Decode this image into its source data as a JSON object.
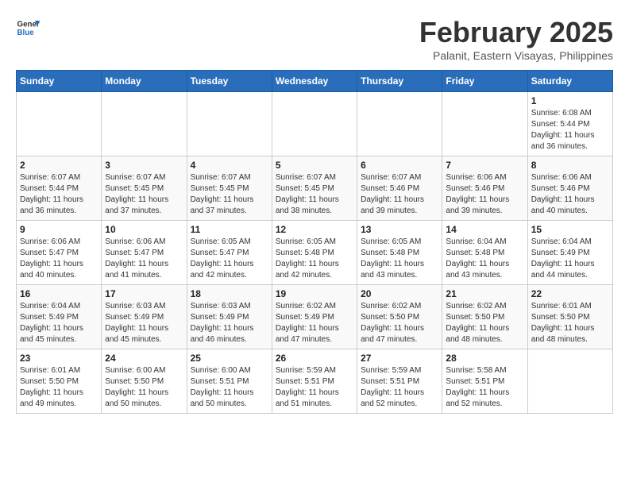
{
  "logo": {
    "text_general": "General",
    "text_blue": "Blue"
  },
  "title": "February 2025",
  "subtitle": "Palanit, Eastern Visayas, Philippines",
  "weekdays": [
    "Sunday",
    "Monday",
    "Tuesday",
    "Wednesday",
    "Thursday",
    "Friday",
    "Saturday"
  ],
  "weeks": [
    [
      {
        "day": "",
        "info": ""
      },
      {
        "day": "",
        "info": ""
      },
      {
        "day": "",
        "info": ""
      },
      {
        "day": "",
        "info": ""
      },
      {
        "day": "",
        "info": ""
      },
      {
        "day": "",
        "info": ""
      },
      {
        "day": "1",
        "info": "Sunrise: 6:08 AM\nSunset: 5:44 PM\nDaylight: 11 hours and 36 minutes."
      }
    ],
    [
      {
        "day": "2",
        "info": "Sunrise: 6:07 AM\nSunset: 5:44 PM\nDaylight: 11 hours and 36 minutes."
      },
      {
        "day": "3",
        "info": "Sunrise: 6:07 AM\nSunset: 5:45 PM\nDaylight: 11 hours and 37 minutes."
      },
      {
        "day": "4",
        "info": "Sunrise: 6:07 AM\nSunset: 5:45 PM\nDaylight: 11 hours and 37 minutes."
      },
      {
        "day": "5",
        "info": "Sunrise: 6:07 AM\nSunset: 5:45 PM\nDaylight: 11 hours and 38 minutes."
      },
      {
        "day": "6",
        "info": "Sunrise: 6:07 AM\nSunset: 5:46 PM\nDaylight: 11 hours and 39 minutes."
      },
      {
        "day": "7",
        "info": "Sunrise: 6:06 AM\nSunset: 5:46 PM\nDaylight: 11 hours and 39 minutes."
      },
      {
        "day": "8",
        "info": "Sunrise: 6:06 AM\nSunset: 5:46 PM\nDaylight: 11 hours and 40 minutes."
      }
    ],
    [
      {
        "day": "9",
        "info": "Sunrise: 6:06 AM\nSunset: 5:47 PM\nDaylight: 11 hours and 40 minutes."
      },
      {
        "day": "10",
        "info": "Sunrise: 6:06 AM\nSunset: 5:47 PM\nDaylight: 11 hours and 41 minutes."
      },
      {
        "day": "11",
        "info": "Sunrise: 6:05 AM\nSunset: 5:47 PM\nDaylight: 11 hours and 42 minutes."
      },
      {
        "day": "12",
        "info": "Sunrise: 6:05 AM\nSunset: 5:48 PM\nDaylight: 11 hours and 42 minutes."
      },
      {
        "day": "13",
        "info": "Sunrise: 6:05 AM\nSunset: 5:48 PM\nDaylight: 11 hours and 43 minutes."
      },
      {
        "day": "14",
        "info": "Sunrise: 6:04 AM\nSunset: 5:48 PM\nDaylight: 11 hours and 43 minutes."
      },
      {
        "day": "15",
        "info": "Sunrise: 6:04 AM\nSunset: 5:49 PM\nDaylight: 11 hours and 44 minutes."
      }
    ],
    [
      {
        "day": "16",
        "info": "Sunrise: 6:04 AM\nSunset: 5:49 PM\nDaylight: 11 hours and 45 minutes."
      },
      {
        "day": "17",
        "info": "Sunrise: 6:03 AM\nSunset: 5:49 PM\nDaylight: 11 hours and 45 minutes."
      },
      {
        "day": "18",
        "info": "Sunrise: 6:03 AM\nSunset: 5:49 PM\nDaylight: 11 hours and 46 minutes."
      },
      {
        "day": "19",
        "info": "Sunrise: 6:02 AM\nSunset: 5:49 PM\nDaylight: 11 hours and 47 minutes."
      },
      {
        "day": "20",
        "info": "Sunrise: 6:02 AM\nSunset: 5:50 PM\nDaylight: 11 hours and 47 minutes."
      },
      {
        "day": "21",
        "info": "Sunrise: 6:02 AM\nSunset: 5:50 PM\nDaylight: 11 hours and 48 minutes."
      },
      {
        "day": "22",
        "info": "Sunrise: 6:01 AM\nSunset: 5:50 PM\nDaylight: 11 hours and 48 minutes."
      }
    ],
    [
      {
        "day": "23",
        "info": "Sunrise: 6:01 AM\nSunset: 5:50 PM\nDaylight: 11 hours and 49 minutes."
      },
      {
        "day": "24",
        "info": "Sunrise: 6:00 AM\nSunset: 5:50 PM\nDaylight: 11 hours and 50 minutes."
      },
      {
        "day": "25",
        "info": "Sunrise: 6:00 AM\nSunset: 5:51 PM\nDaylight: 11 hours and 50 minutes."
      },
      {
        "day": "26",
        "info": "Sunrise: 5:59 AM\nSunset: 5:51 PM\nDaylight: 11 hours and 51 minutes."
      },
      {
        "day": "27",
        "info": "Sunrise: 5:59 AM\nSunset: 5:51 PM\nDaylight: 11 hours and 52 minutes."
      },
      {
        "day": "28",
        "info": "Sunrise: 5:58 AM\nSunset: 5:51 PM\nDaylight: 11 hours and 52 minutes."
      },
      {
        "day": "",
        "info": ""
      }
    ]
  ]
}
